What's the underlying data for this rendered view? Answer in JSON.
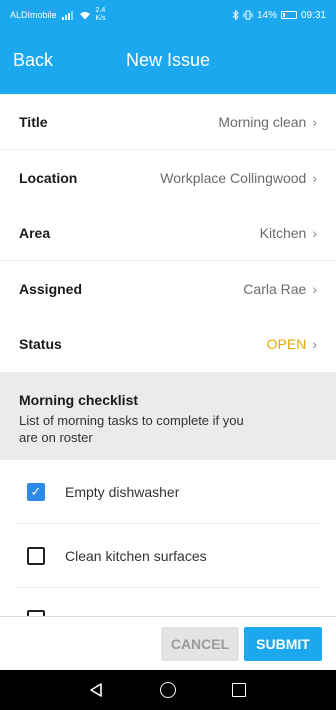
{
  "status_bar": {
    "carrier": "ALDImobile",
    "speed_top": "2.4",
    "speed_bottom": "K/s",
    "battery": "14%",
    "battery_level": 0.14,
    "time": "09:31"
  },
  "nav": {
    "back_label": "Back",
    "title": "New Issue"
  },
  "fields": [
    {
      "label": "Title",
      "value": "Morning clean"
    },
    {
      "label": "Location",
      "value": "Workplace Collingwood"
    },
    {
      "label": "Area",
      "value": "Kitchen"
    },
    {
      "label": "Assigned",
      "value": "Carla Rae"
    },
    {
      "label": "Status",
      "value": "OPEN"
    }
  ],
  "checklist": {
    "title": "Morning checklist",
    "description": "List of morning tasks to complete if you are on roster",
    "items": [
      {
        "label": "Empty dishwasher",
        "checked": true
      },
      {
        "label": "Clean kitchen surfaces",
        "checked": false
      }
    ]
  },
  "footer": {
    "cancel_label": "CANCEL",
    "submit_label": "SUBMIT"
  },
  "colors": {
    "primary": "#1ba8ee",
    "status_open": "#e8a800",
    "checkbox_checked": "#2b8be6"
  }
}
